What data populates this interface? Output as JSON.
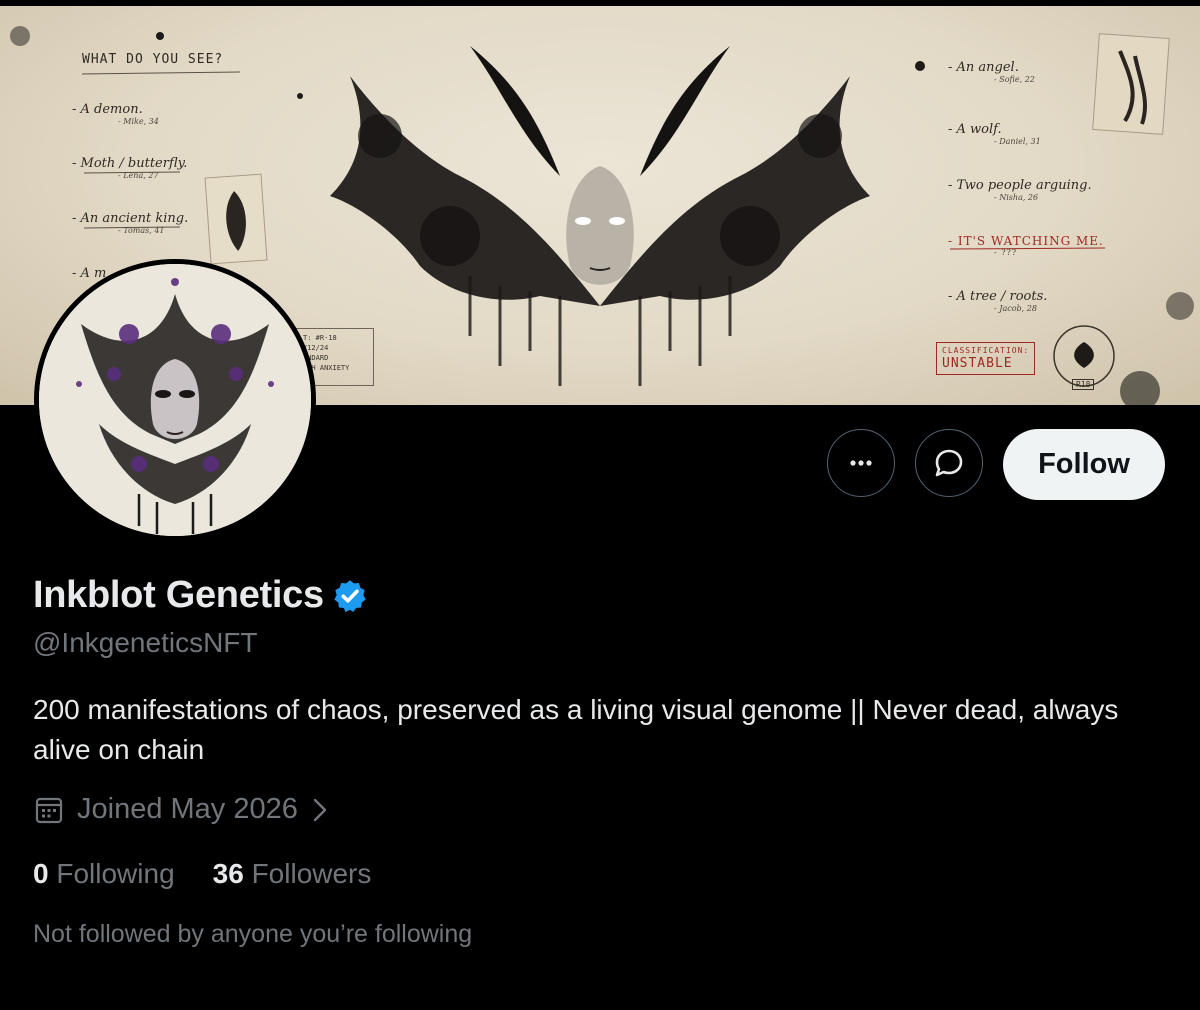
{
  "banner": {
    "question": "WHAT DO YOU SEE?",
    "left_answers": [
      {
        "text": "- A demon.",
        "by": "- Mike, 34"
      },
      {
        "text": "- Moth / butterfly.",
        "by": "- Lena, 27"
      },
      {
        "text": "- An ancient king.",
        "by": "- Tomas, 41"
      },
      {
        "text": "- A m"
      }
    ],
    "right_answers": [
      {
        "text": "- An angel.",
        "by": "- Sofie, 22"
      },
      {
        "text": "- A wolf.",
        "by": "- Daniel, 31"
      },
      {
        "text": "- Two people arguing.",
        "by": "- Nisha, 26"
      },
      {
        "text": "- IT'S WATCHING ME.",
        "by": "- ???"
      },
      {
        "text": "- A tree / roots.",
        "by": "- Jacob, 28"
      }
    ],
    "card_lines": [
      "T: #R-18",
      "/12/24",
      "ANDARD",
      "IGH ANXIETY"
    ],
    "stamp_label": "CLASSIFICATION:",
    "stamp_value": "UNSTABLE",
    "badge_label": "R18"
  },
  "actions": {
    "more_icon": "more-horizontal-icon",
    "message_icon": "message-bubble-icon",
    "follow_label": "Follow"
  },
  "profile": {
    "name": "Inkblot Genetics",
    "verified_icon": "verified-badge-icon",
    "handle": "@InkgeneticsNFT",
    "bio": "200 manifestations of chaos, preserved as a living visual genome || Never dead, always alive on chain",
    "joined": "Joined May 2026",
    "following_count": "0",
    "following_label": "Following",
    "followers_count": "36",
    "followers_label": "Followers",
    "not_followed": "Not followed by anyone you’re following"
  },
  "colors": {
    "background": "#000000",
    "text_primary": "#e7e9ea",
    "text_secondary": "#71767b",
    "verified_blue": "#1d9bf0",
    "follow_button_bg": "#eff3f4"
  }
}
